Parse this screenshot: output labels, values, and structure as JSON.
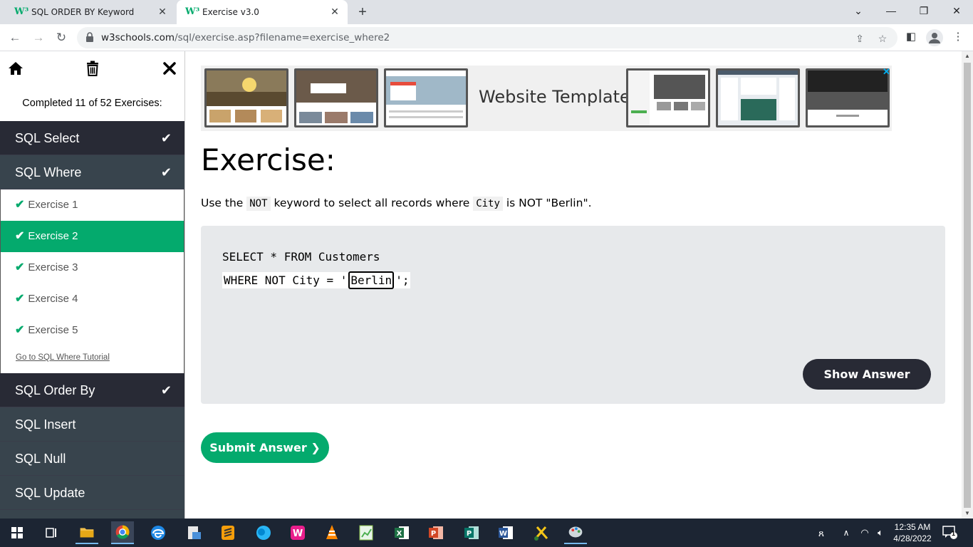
{
  "browser": {
    "tabs": [
      {
        "title": "SQL ORDER BY Keyword",
        "favicon": "W³"
      },
      {
        "title": "Exercise v3.0",
        "favicon": "W³"
      }
    ],
    "url_host": "w3schools.com",
    "url_path": "/sql/exercise.asp?filename=exercise_where2"
  },
  "sidebar": {
    "completed_text": "Completed 11 of 52 Exercises:",
    "sections_top": [
      {
        "label": "SQL Select",
        "done": true
      },
      {
        "label": "SQL Where",
        "done": true
      }
    ],
    "exercises": [
      {
        "label": "Exercise 1"
      },
      {
        "label": "Exercise 2"
      },
      {
        "label": "Exercise 3"
      },
      {
        "label": "Exercise 4"
      },
      {
        "label": "Exercise 5"
      }
    ],
    "tutorial_link": "Go to SQL Where Tutorial",
    "sections_bottom": [
      {
        "label": "SQL Order By",
        "done": true
      },
      {
        "label": "SQL Insert",
        "done": false
      },
      {
        "label": "SQL Null",
        "done": false
      },
      {
        "label": "SQL Update",
        "done": false
      }
    ]
  },
  "ad": {
    "text": "Website Templates"
  },
  "main": {
    "heading": "Exercise:",
    "instruction": {
      "part1": "Use the ",
      "code1": "NOT",
      "part2": " keyword to select all records where ",
      "code2": "City",
      "part3": " is NOT \"Berlin\"."
    },
    "code": {
      "line1": "SELECT * FROM Customers",
      "line2_prefix": "WHERE NOT City = '",
      "answer_value": "Berlin",
      "line2_suffix": "';"
    },
    "show_answer_label": "Show Answer",
    "submit_label": "Submit Answer ❯"
  },
  "taskbar": {
    "time": "12:35 AM",
    "date": "4/28/2022",
    "notification_count": "1"
  }
}
